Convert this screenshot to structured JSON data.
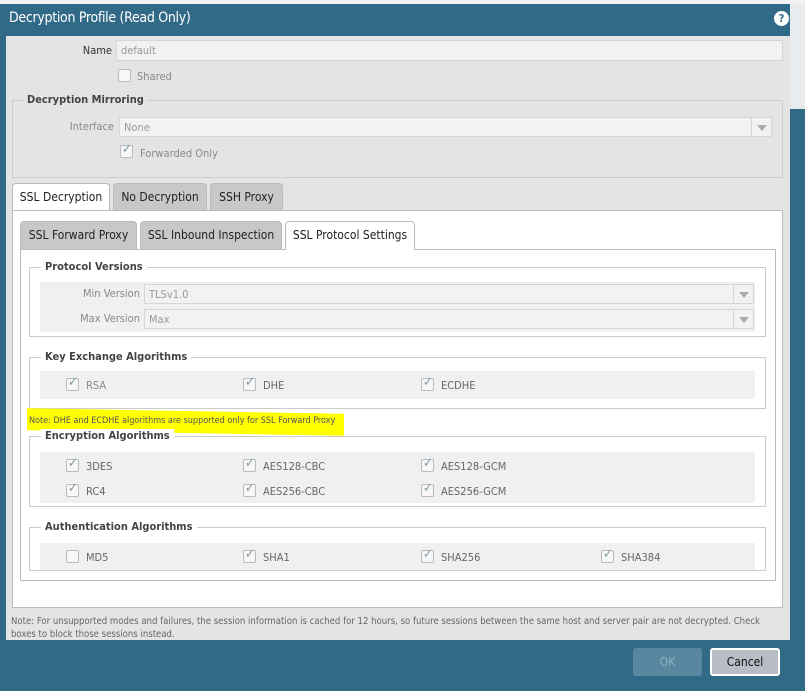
{
  "dialog": {
    "title": "Decryption Profile (Read Only)",
    "help_icon": "help-icon"
  },
  "name": {
    "label": "Name",
    "value": "default"
  },
  "shared": {
    "label": "Shared",
    "checked": false
  },
  "mirroring": {
    "legend": "Decryption Mirroring",
    "interface_label": "Interface",
    "interface_value": "None",
    "forwarded_only_label": "Forwarded Only",
    "forwarded_only_checked": true
  },
  "outer_tabs": [
    "SSL Decryption",
    "No Decryption",
    "SSH Proxy"
  ],
  "inner_tabs": [
    "SSL Forward Proxy",
    "SSL Inbound Inspection",
    "SSL Protocol Settings"
  ],
  "protocol_versions": {
    "legend": "Protocol Versions",
    "min_label": "Min Version",
    "min_value": "TLSv1.0",
    "max_label": "Max Version",
    "max_value": "Max"
  },
  "key_exchange": {
    "legend": "Key Exchange Algorithms",
    "items": [
      {
        "label": "RSA",
        "checked": true
      },
      {
        "label": "DHE",
        "checked": true
      },
      {
        "label": "ECDHE",
        "checked": true
      }
    ]
  },
  "highlight_note": "Note: DHE and ECDHE algorithms are supported only for SSL Forward Proxy",
  "highlight_color": "#ffff00",
  "encryption": {
    "legend": "Encryption Algorithms",
    "items": [
      {
        "label": "3DES",
        "checked": true
      },
      {
        "label": "AES128-CBC",
        "checked": true
      },
      {
        "label": "AES128-GCM",
        "checked": true
      },
      {
        "label": "RC4",
        "checked": true
      },
      {
        "label": "AES256-CBC",
        "checked": true
      },
      {
        "label": "AES256-GCM",
        "checked": true
      }
    ]
  },
  "authentication": {
    "legend": "Authentication Algorithms",
    "items": [
      {
        "label": "MD5",
        "checked": false
      },
      {
        "label": "SHA1",
        "checked": true
      },
      {
        "label": "SHA256",
        "checked": true
      },
      {
        "label": "SHA384",
        "checked": true
      }
    ]
  },
  "footer_note": "Note: For unsupported modes and failures, the session information is cached for 12 hours, so future sessions between the same host and server pair are not decrypted. Check boxes to block those sessions instead.",
  "buttons": {
    "ok": "OK",
    "cancel": "Cancel"
  },
  "colors": {
    "frame": "#316a87",
    "body": "#e4e4e4"
  }
}
